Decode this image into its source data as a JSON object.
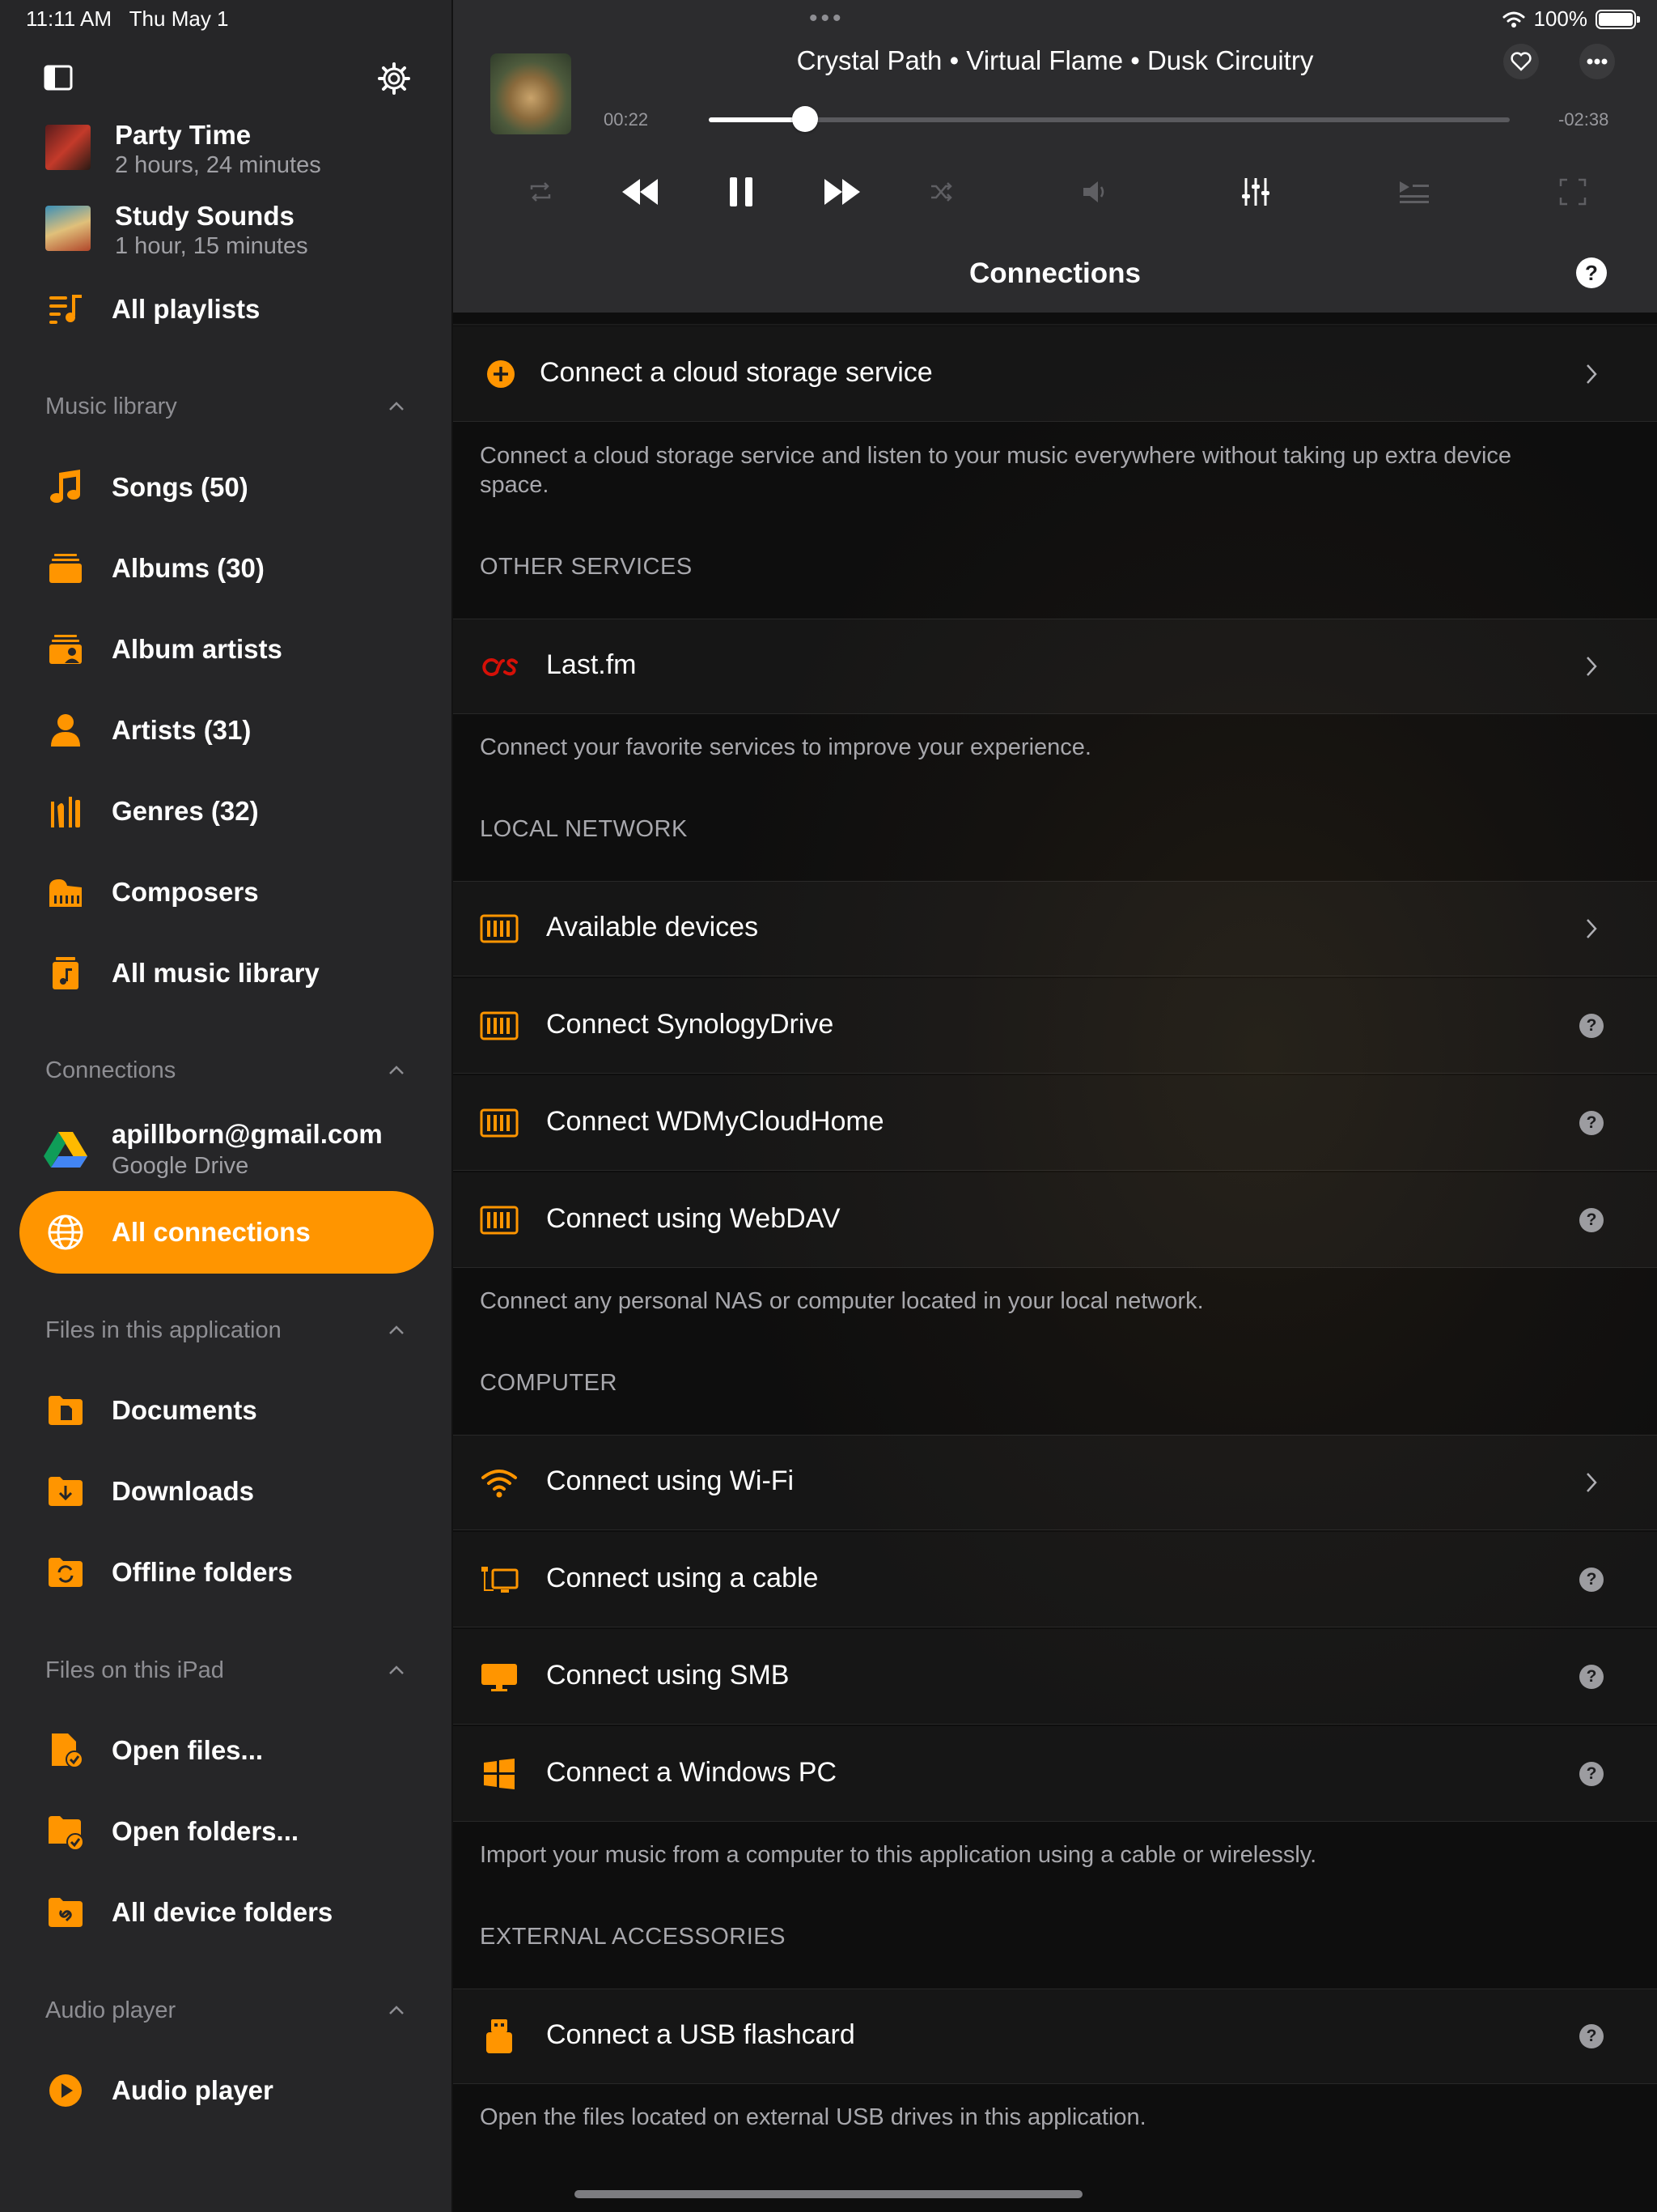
{
  "status_bar": {
    "time": "11:11 AM",
    "date": "Thu May 1",
    "battery": "100%"
  },
  "colors": {
    "accent": "#ff9500",
    "lastfm": "#d51007"
  },
  "sidebar": {
    "playlists": [
      {
        "title": "Party Time",
        "subtitle": "2 hours, 24 minutes"
      },
      {
        "title": "Study Sounds",
        "subtitle": "1 hour, 15 minutes"
      }
    ],
    "all_playlists": "All playlists",
    "music_library": {
      "header": "Music library",
      "items": [
        "Songs (50)",
        "Albums (30)",
        "Album artists",
        "Artists (31)",
        "Genres (32)",
        "Composers",
        "All music library"
      ]
    },
    "connections": {
      "header": "Connections",
      "account_email": "apillborn@gmail.com",
      "account_service": "Google Drive",
      "all_connections": "All connections"
    },
    "files_app": {
      "header": "Files in this application",
      "items": [
        "Documents",
        "Downloads",
        "Offline folders"
      ]
    },
    "files_ipad": {
      "header": "Files on this iPad",
      "items": [
        "Open files...",
        "Open folders...",
        "All device folders"
      ]
    },
    "audio_player": {
      "header": "Audio player",
      "item": "Audio player"
    }
  },
  "player": {
    "now_playing": "Crystal Path • Virtual Flame • Dusk Circuitry",
    "elapsed": "00:22",
    "remaining": "-02:38",
    "progress": 0.12
  },
  "page": {
    "title": "Connections",
    "cloud_row": "Connect a cloud storage service",
    "cloud_note": "Connect a cloud storage service and listen to your music everywhere without taking up extra device space.",
    "other_services_header": "OTHER SERVICES",
    "lastfm_row": "Last.fm",
    "other_note": "Connect your favorite services to improve your experience.",
    "local_network_header": "LOCAL NETWORK",
    "local_rows": [
      "Available devices",
      "Connect SynologyDrive",
      "Connect WDMyCloudHome",
      "Connect using WebDAV"
    ],
    "local_note": "Connect any personal NAS or computer located in your local network.",
    "computer_header": "COMPUTER",
    "computer_rows": [
      "Connect using Wi-Fi",
      "Connect using a cable",
      "Connect using SMB",
      "Connect a Windows PC"
    ],
    "computer_note": "Import your music from a computer to this application using a cable or wirelessly.",
    "external_header": "EXTERNAL ACCESSORIES",
    "usb_row": "Connect a USB flashcard",
    "external_note": "Open the files located on external USB drives in this application."
  }
}
